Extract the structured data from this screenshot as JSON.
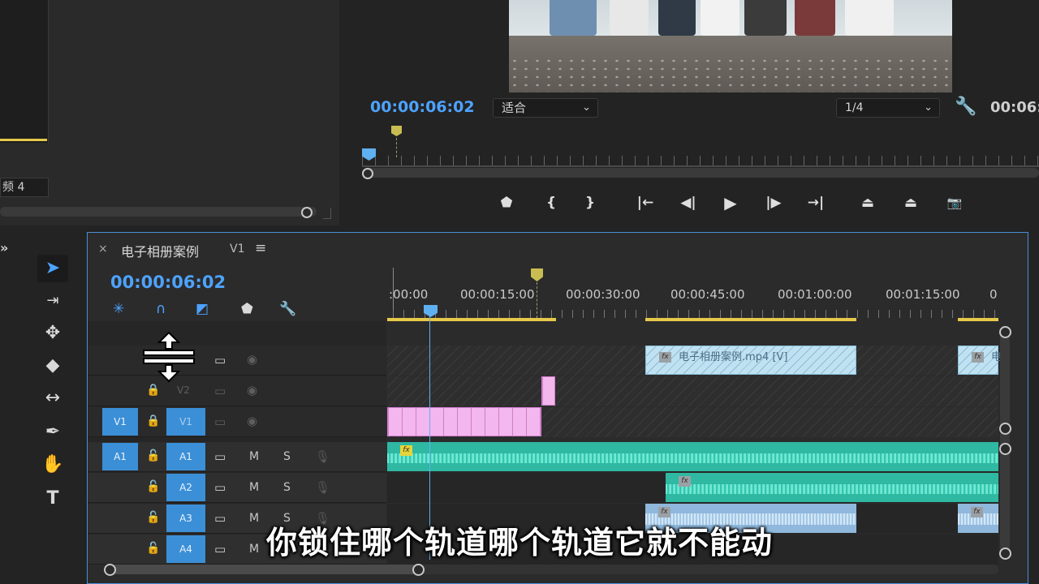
{
  "project_panel": {
    "item_label": "频 4"
  },
  "program_monitor": {
    "timecode": "00:00:06:02",
    "zoom_value": "适合",
    "resolution_value": "1/4",
    "right_timecode": "00:06:",
    "transport": [
      {
        "name": "add-marker-button",
        "glyph": "⬟"
      },
      {
        "name": "mark-in-button",
        "glyph": "{"
      },
      {
        "name": "mark-out-button",
        "glyph": "}"
      },
      {
        "name": "go-to-in-button",
        "glyph": "|←"
      },
      {
        "name": "step-back-button",
        "glyph": "◀|"
      },
      {
        "name": "play-button",
        "glyph": "▶"
      },
      {
        "name": "step-forward-button",
        "glyph": "|▶"
      },
      {
        "name": "go-to-out-button",
        "glyph": "→|"
      },
      {
        "name": "lift-button",
        "glyph": "⏏"
      },
      {
        "name": "extract-button",
        "glyph": "⏏"
      },
      {
        "name": "export-frame-button",
        "glyph": "📷"
      }
    ]
  },
  "timeline": {
    "title": "电子相册案例",
    "track_tag": "V1",
    "timecode": "00:00:06:02",
    "ruler_labels": [
      ":00:00",
      "00:00:15:00",
      "00:00:30:00",
      "00:00:45:00",
      "00:01:00:00",
      "00:01:15:00",
      "0"
    ],
    "tracks": {
      "v2": {
        "target": "V2"
      },
      "v1": {
        "source": "V1",
        "target": "V1"
      },
      "a1": {
        "source": "A1",
        "target": "A1",
        "mute": "M",
        "solo": "S"
      },
      "a2": {
        "target": "A2",
        "mute": "M",
        "solo": "S"
      },
      "a3": {
        "target": "A3",
        "mute": "M",
        "solo": "S"
      },
      "a4": {
        "target": "A4",
        "mute": "M",
        "solo": "S"
      }
    },
    "clips": {
      "v3_main_label": "电子相册案例.mp4 [V]",
      "v3_end_label": "电",
      "fx": "fx"
    }
  },
  "subtitle": "你锁住哪个轨道哪个轨道它就不能动",
  "colors": {
    "accent_blue": "#4da3ff",
    "playhead": "#5fb0f0",
    "audio_clip": "#2fb8a2",
    "video_clip": "#bfe2f2",
    "pink_clip": "#f3b6ee",
    "work_area": "#e6c84a"
  }
}
